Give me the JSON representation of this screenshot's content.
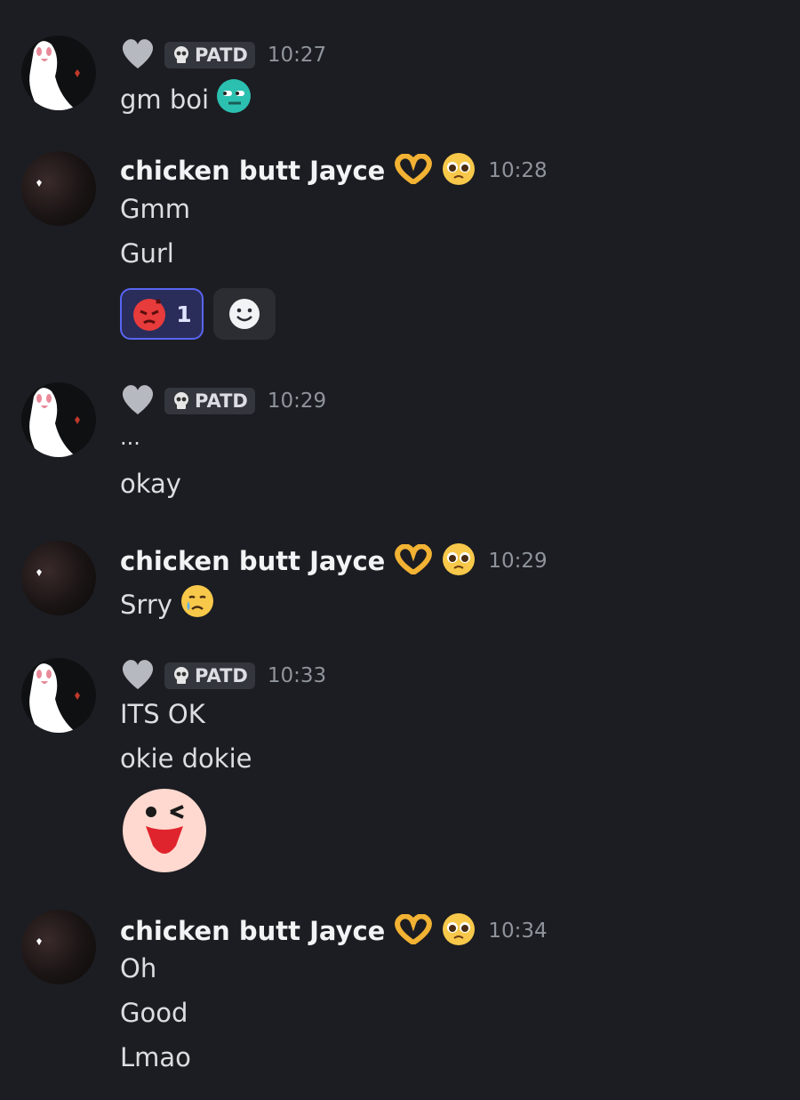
{
  "messages": [
    {
      "author": "",
      "badge": "PATD",
      "time": "10:27",
      "lines": [
        "gm boi"
      ]
    },
    {
      "author": "chicken butt Jayce",
      "time": "10:28",
      "lines": [
        "Gmm",
        "Gurl"
      ],
      "reactions": [
        {
          "emoji": "angry-face",
          "count": "1"
        }
      ]
    },
    {
      "author": "",
      "badge": "PATD",
      "time": "10:29",
      "lines": [
        "...",
        "okay"
      ]
    },
    {
      "author": "chicken butt Jayce",
      "time": "10:29",
      "lines": [
        "Srry"
      ]
    },
    {
      "author": "",
      "badge": "PATD",
      "time": "10:33",
      "lines": [
        "ITS OK",
        "okie dokie"
      ]
    },
    {
      "author": "chicken butt Jayce",
      "time": "10:34",
      "lines": [
        "Oh",
        "Good",
        "Lmao"
      ]
    }
  ],
  "colors": {
    "background": "#1c1d22",
    "reaction_selected_border": "#5865f2",
    "reaction_selected_bg": "#2a2d5a"
  }
}
